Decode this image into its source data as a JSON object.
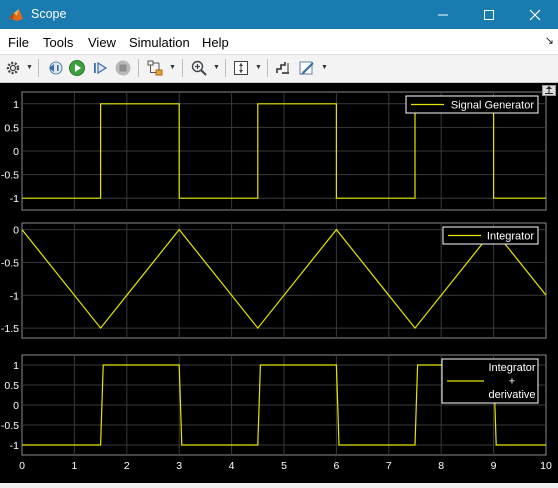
{
  "window": {
    "title": "Scope",
    "titlebar_color": "#1a7bb0"
  },
  "menu": [
    "File",
    "Tools",
    "View",
    "Simulation",
    "Help"
  ],
  "toolbar": {
    "icons": [
      "settings-gear-icon",
      "step-back-icon",
      "run-icon",
      "step-forward-icon",
      "stop-icon",
      "highlight-block-icon",
      "zoom-icon",
      "scale-axes-icon",
      "cursor-measurement-icon",
      "style-brush-icon"
    ]
  },
  "colors": {
    "plot_bg": "#000000",
    "axes_bg": "#000000",
    "grid": "#3a3a3a",
    "trace": "#e6e600",
    "tick_text": "#ffffff"
  },
  "x_ticks": [
    "0",
    "1",
    "2",
    "3",
    "4",
    "5",
    "6",
    "7",
    "8",
    "9",
    "10"
  ],
  "chart_data": [
    {
      "type": "line",
      "legend": [
        "Signal Generator"
      ],
      "legend_position": "top-right",
      "grid": true,
      "xlim": [
        0,
        10
      ],
      "ylim": [
        -1.25,
        1.25
      ],
      "yticks": [
        "1",
        "0.5",
        "0",
        "-0.5",
        "-1"
      ],
      "yvalues": [
        1,
        0.5,
        0,
        -0.5,
        -1
      ],
      "series": [
        {
          "x": [
            0,
            1.5,
            1.5,
            3,
            3,
            4.5,
            4.5,
            6,
            6,
            7.5,
            7.5,
            9,
            9,
            10
          ],
          "y": [
            -1,
            -1,
            1,
            1,
            -1,
            -1,
            1,
            1,
            -1,
            -1,
            1,
            1,
            -1,
            -1
          ]
        }
      ]
    },
    {
      "type": "line",
      "legend": [
        "Integrator"
      ],
      "legend_position": "top-right",
      "grid": true,
      "xlim": [
        0,
        10
      ],
      "ylim": [
        -1.65,
        0.1
      ],
      "yticks": [
        "0",
        "-0.5",
        "-1",
        "-1.5"
      ],
      "yvalues": [
        0,
        -0.5,
        -1,
        -1.5
      ],
      "series": [
        {
          "x": [
            0,
            1.5,
            3,
            4.5,
            6,
            7.5,
            9,
            10
          ],
          "y": [
            0,
            -1.5,
            0,
            -1.5,
            0,
            -1.5,
            0,
            -1
          ]
        }
      ]
    },
    {
      "type": "line",
      "legend": [
        "Integrator",
        "+",
        "derivative"
      ],
      "legend_position": "top-right",
      "grid": true,
      "xlim": [
        0,
        10
      ],
      "ylim": [
        -1.25,
        1.25
      ],
      "yticks": [
        "1",
        "0.5",
        "0",
        "-0.5",
        "-1"
      ],
      "yvalues": [
        1,
        0.5,
        0,
        -0.5,
        -1
      ],
      "series": [
        {
          "x": [
            0,
            1.5,
            1.55,
            3,
            3.05,
            4.5,
            4.55,
            6,
            6.05,
            7.5,
            7.55,
            9,
            9.05,
            10
          ],
          "y": [
            -1,
            -1,
            1,
            1,
            -1,
            -1,
            1,
            1,
            -1,
            -1,
            1,
            1,
            -1,
            -1
          ]
        }
      ]
    }
  ]
}
